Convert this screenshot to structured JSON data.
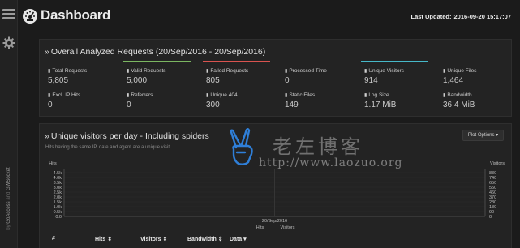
{
  "header": {
    "title": "Dashboard",
    "last_updated_label": "Last Updated:",
    "last_updated_value": "2016-09-20 15:17:07"
  },
  "sidebar": {
    "credit_prefix": "by",
    "credit_author": "GoAccess",
    "credit_and": "and",
    "credit_author2": "GWSocket"
  },
  "overall": {
    "title": "Overall Analyzed Requests (20/Sep/2016 - 20/Sep/2016)",
    "stats": [
      {
        "label": "Total Requests",
        "value": "5,805",
        "bar": ""
      },
      {
        "label": "Valid Requests",
        "value": "5,000",
        "bar": "#7bb661"
      },
      {
        "label": "Failed Requests",
        "value": "805",
        "bar": "#d9534f"
      },
      {
        "label": "Processed Time",
        "value": "0",
        "bar": ""
      },
      {
        "label": "Unique Visitors",
        "value": "914",
        "bar": "#46b8c8"
      },
      {
        "label": "Unique Files",
        "value": "1,464",
        "bar": ""
      },
      {
        "label": "Excl. IP Hits",
        "value": "0",
        "bar": ""
      },
      {
        "label": "Referrers",
        "value": "0",
        "bar": ""
      },
      {
        "label": "Unique 404",
        "value": "300",
        "bar": ""
      },
      {
        "label": "Static Files",
        "value": "149",
        "bar": ""
      },
      {
        "label": "Log Size",
        "value": "1.17 MiB",
        "bar": ""
      },
      {
        "label": "Bandwidth",
        "value": "36.4 MiB",
        "bar": ""
      }
    ]
  },
  "visitors_panel": {
    "title": "Unique visitors per day - Including spiders",
    "subtitle": "Hits having the same IP, date and agent are a unique visit.",
    "plot_options": "Plot Options"
  },
  "chart_data": {
    "type": "bar",
    "categories": [
      "20/Sep/2016"
    ],
    "series": [
      {
        "name": "Hits",
        "values": [
          4800
        ]
      },
      {
        "name": "Visitors",
        "values": [
          914
        ]
      }
    ],
    "ylabel_left": "Hits",
    "ylabel_right": "Visitors",
    "yticks_left": [
      "4.5k",
      "4.0k",
      "3.5k",
      "3.0k",
      "2.5k",
      "2.0k",
      "1.5k",
      "1.0k",
      "0.5k",
      "0.0"
    ],
    "yticks_right": [
      "830",
      "740",
      "650",
      "550",
      "460",
      "370",
      "280",
      "180",
      "90",
      "0"
    ],
    "xlabels": [
      "Hits",
      "Visitors"
    ],
    "grid": true
  },
  "table": {
    "headers": [
      "#",
      "Hits",
      "Visitors",
      "Bandwidth",
      "Data"
    ]
  },
  "watermark": {
    "cn": "老左博客",
    "url": "http://www.laozuo.org"
  },
  "colors": {
    "valid": "#7bb661",
    "failed": "#d9534f",
    "visitors": "#46b8c8"
  }
}
